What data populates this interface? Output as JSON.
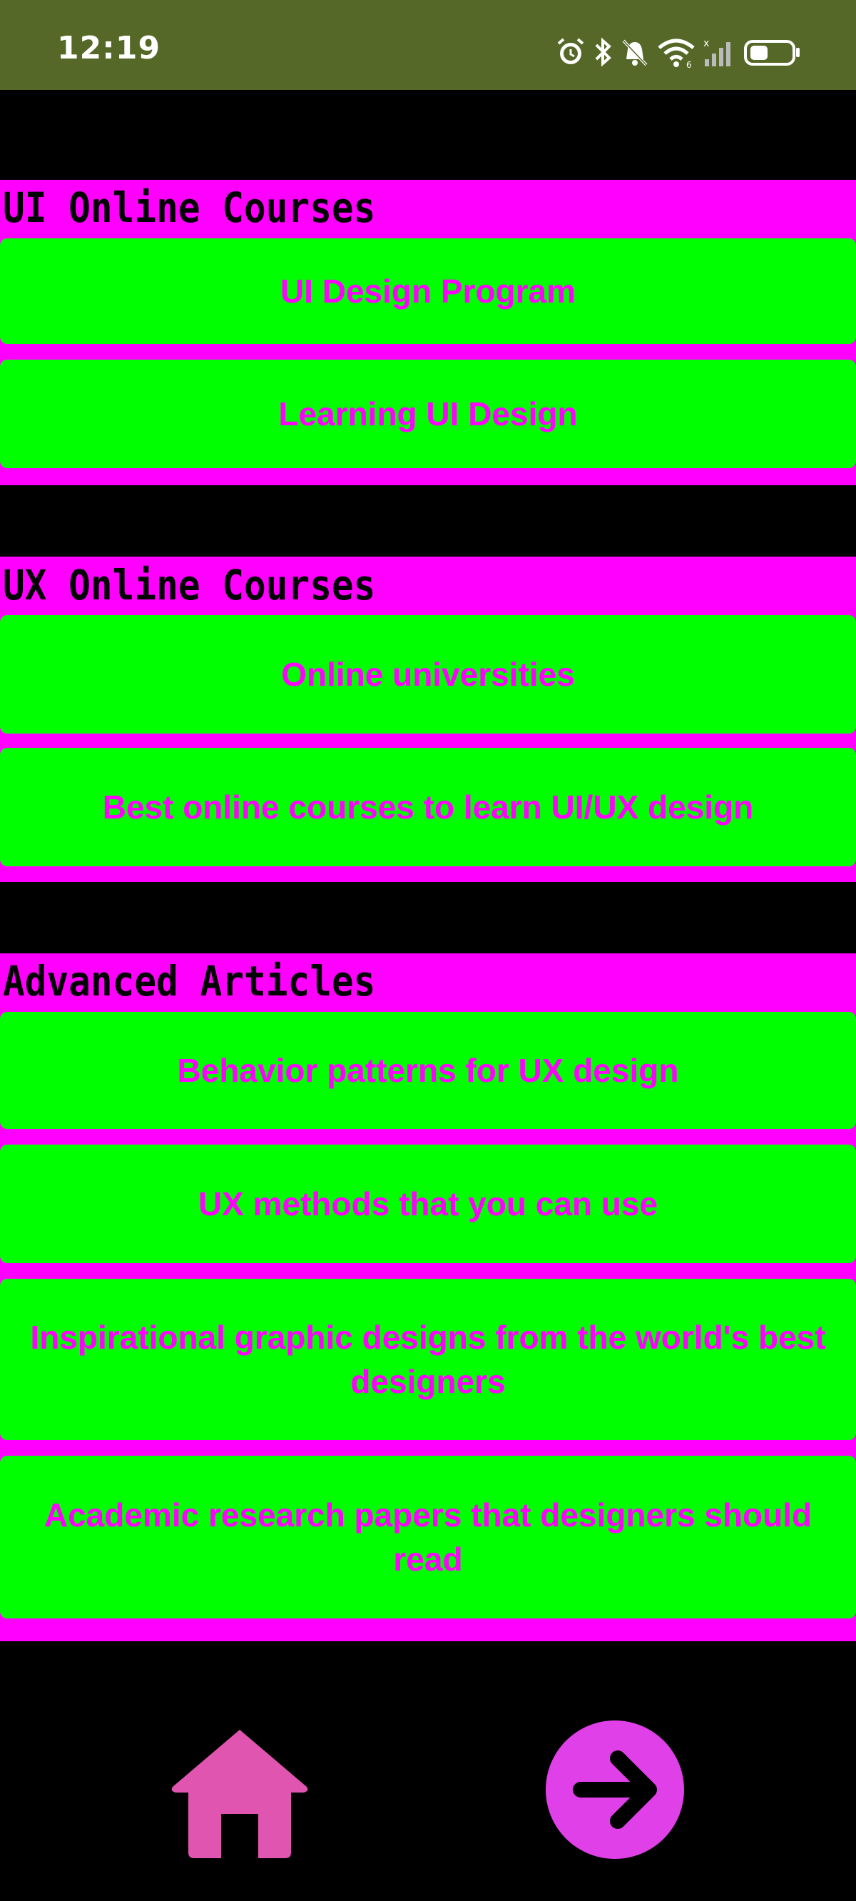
{
  "status_bar": {
    "time": "12:19",
    "icons": [
      "alarm-icon",
      "bluetooth-icon",
      "mute-icon",
      "wifi-icon",
      "signal-icon",
      "battery-icon"
    ]
  },
  "sections": [
    {
      "title": "UI Online Courses",
      "buttons": [
        "UI Design Program",
        "Learning UI Design"
      ]
    },
    {
      "title": "UX Online Courses",
      "buttons": [
        "Online universities",
        "Best online courses to learn UI/UX design"
      ]
    },
    {
      "title": "Advanced Articles",
      "buttons": [
        "Behavior patterns for UX design",
        "UX methods that you can use",
        "Inspirational graphic designs from the world's best designers",
        "Academic research papers that designers should read"
      ]
    }
  ],
  "colors": {
    "section_bg": "#ff00ff",
    "button_bg": "#00ff00",
    "button_text": "#ff00ff",
    "status_bar_bg": "#556827",
    "home_icon": "#e055b0",
    "next_icon": "#e040e8"
  },
  "bottom_nav": {
    "home_icon": "home-icon",
    "next_icon": "arrow-right-icon"
  }
}
